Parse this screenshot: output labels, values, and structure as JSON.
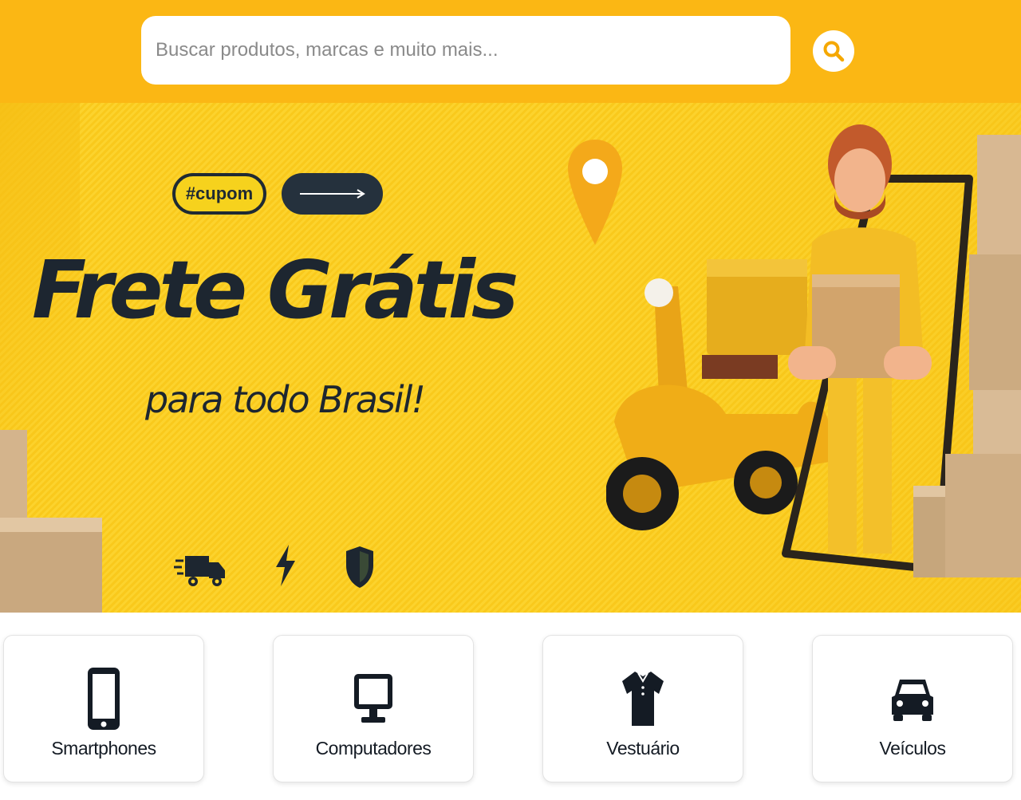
{
  "search": {
    "placeholder": "Buscar produtos, marcas e muito mais..."
  },
  "banner": {
    "tag": "#cupom",
    "headline": "Frete Grátis",
    "subheadline": "para todo Brasil!",
    "features": [
      "truck-icon",
      "lightning-icon",
      "shield-icon"
    ]
  },
  "categories": [
    {
      "label": "Smartphones",
      "icon": "smartphone-icon"
    },
    {
      "label": "Computadores",
      "icon": "monitor-icon"
    },
    {
      "label": "Vestuário",
      "icon": "shirt-icon"
    },
    {
      "label": "Veículos",
      "icon": "car-icon"
    }
  ],
  "colors": {
    "brand_yellow": "#fbb714",
    "banner_yellow": "#fcd32d",
    "dark": "#1d2630"
  }
}
